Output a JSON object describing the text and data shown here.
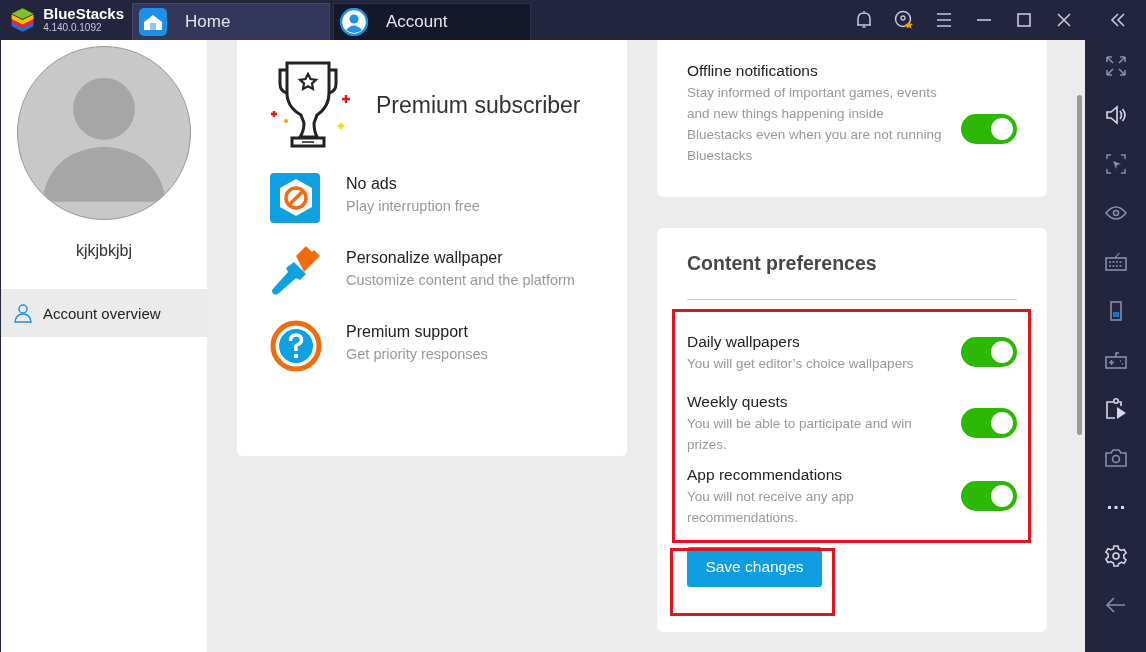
{
  "app": {
    "name": "BlueStacks",
    "version": "4.140.0.1092"
  },
  "tabs": [
    {
      "label": "Home",
      "kind": "home",
      "selected": false
    },
    {
      "label": "Account",
      "kind": "account",
      "selected": true
    }
  ],
  "profile": {
    "username": "kjkjbkjbj"
  },
  "nav": [
    {
      "label": "Account overview",
      "selected": true
    }
  ],
  "premium": {
    "title": "Premium subscriber",
    "benefits": [
      {
        "kind": "noads",
        "title": "No ads",
        "subtitle": "Play interruption free"
      },
      {
        "kind": "brush",
        "title": "Personalize wallpaper",
        "subtitle": "Customize content and the platform"
      },
      {
        "kind": "support",
        "title": "Premium support",
        "subtitle": "Get priority responses"
      }
    ]
  },
  "notifications": {
    "title": "Offline notifications",
    "description": "Stay informed of important games, events and new things happening inside Bluestacks even when you are not running Bluestacks",
    "on": true
  },
  "content_preferences": {
    "title": "Content preferences",
    "items": [
      {
        "title": "Daily wallpapers",
        "description": "You will get editor’s choice wallpapers",
        "on": true
      },
      {
        "title": "Weekly quests",
        "description": "You will be able to participate and win prizes.",
        "on": true
      },
      {
        "title": "App recommendations",
        "description": "You will not receive any app recommendations.",
        "on": true
      }
    ],
    "save_label": "Save changes"
  }
}
